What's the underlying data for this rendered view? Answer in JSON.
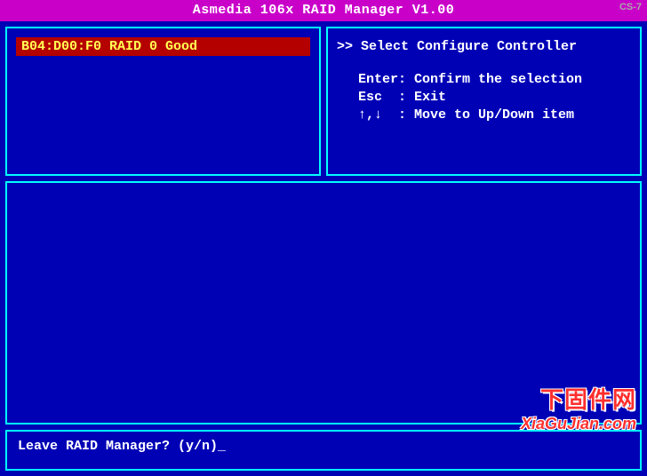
{
  "title": "Asmedia 106x RAID Manager V1.00",
  "bezel_label": "CS-7",
  "left_panel": {
    "raid_item": "B04:D00:F0 RAID 0 Good"
  },
  "right_panel": {
    "title": ">> Select Configure Controller",
    "help": {
      "enter": "Enter: Confirm the selection",
      "esc": "Esc  : Exit",
      "arrows": "↑,↓  : Move to Up/Down item"
    }
  },
  "prompt": {
    "text": "Leave RAID Manager? (y/n)",
    "cursor": "_"
  },
  "watermark": {
    "cn": "下固件网",
    "en": "XiaGuJian.com"
  }
}
